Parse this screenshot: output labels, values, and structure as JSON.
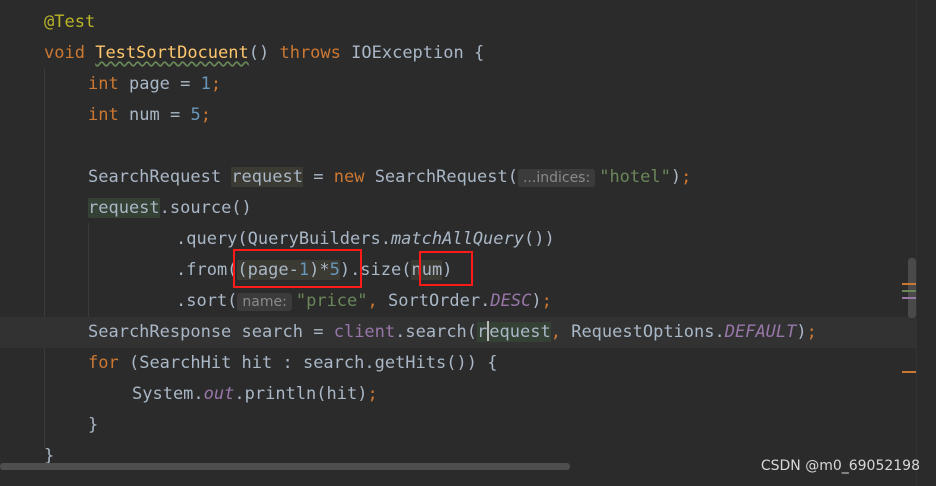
{
  "editor": {
    "annotation": "@Test",
    "method": {
      "void_kw": "void",
      "name": "TestSortDocuent",
      "params": "()",
      "throws_kw": "throws",
      "exception": "IOException",
      "brace": "{"
    },
    "page_decl": {
      "type": "int",
      "name": "page",
      "eq": "=",
      "value": "1",
      "semi": ";"
    },
    "num_decl": {
      "type": "int",
      "name": "num",
      "eq": "=",
      "value": "5",
      "semi": ";"
    },
    "request_decl": {
      "type": "SearchRequest",
      "var": "request",
      "eq": "=",
      "new_kw": "new",
      "ctor": "SearchRequest(",
      "hint": "...indices:",
      "arg": "\"hotel\"",
      "close": ")",
      "semi": ";"
    },
    "source_line": {
      "var": "request",
      "call": ".source()"
    },
    "query_line": {
      "pre": ".query(QueryBuilders.",
      "method": "matchAllQuery",
      "post": "())"
    },
    "from_line": {
      "pre": ".from(",
      "expr_open": "(page-",
      "expr_num": "1",
      "expr_mid": ")*",
      "expr_num2": "5",
      "mid": ").size(",
      "size_arg": "num",
      "post": ")"
    },
    "sort_line": {
      "pre": ".sort(",
      "hint": "name:",
      "arg": "\"price\"",
      "comma": ",",
      "enum_pre": "SortOrder.",
      "enum_val": "DESC",
      "post": ")",
      "semi": ";"
    },
    "search_line": {
      "type": "SearchResponse",
      "var": "search",
      "eq": "=",
      "client": "client",
      "call": ".search(",
      "arg_r": "r",
      "arg_rest": "equest",
      "comma": ",",
      "opts_pre": "RequestOptions.",
      "opts_val": "DEFAULT",
      "post": ")",
      "semi": ";"
    },
    "for_line": {
      "kw": "for",
      "body": "(SearchHit hit : search.getHits()) {"
    },
    "print_line": {
      "pre": "System.",
      "field": "out",
      "post": ".println(hit)",
      "semi": ";"
    },
    "close_inner": "}",
    "close_outer": "}"
  },
  "watermark": "CSDN @m0_69052198",
  "colors": {
    "background": "#2b2b2b",
    "keyword": "#cc7832",
    "function": "#ffc66d",
    "number": "#6897bb",
    "string": "#6a8759",
    "static_field": "#9876aa",
    "annotation": "#bbb529",
    "highlight_box": "#ff1a1a"
  }
}
